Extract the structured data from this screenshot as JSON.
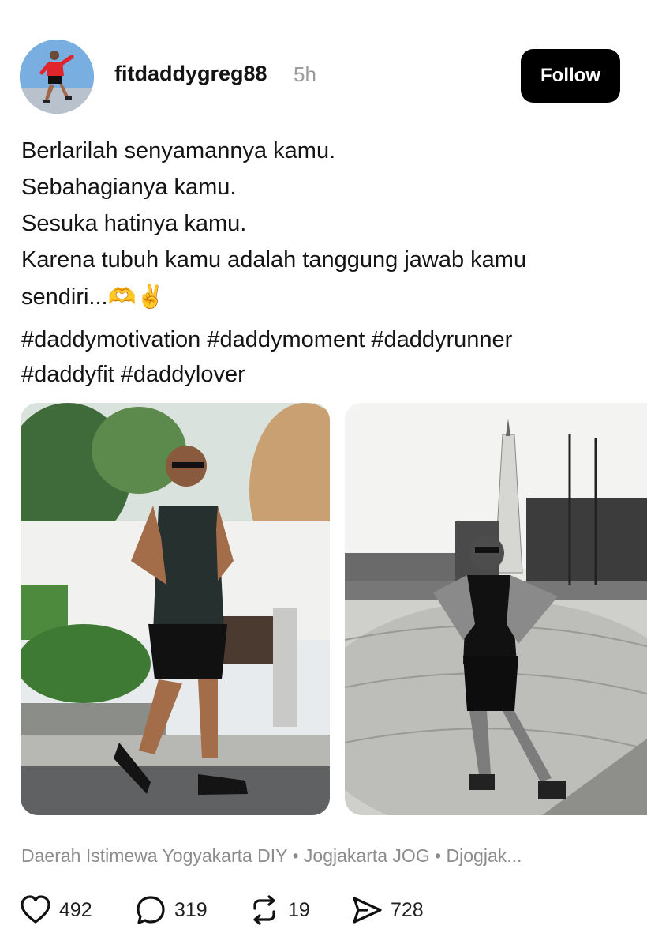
{
  "post": {
    "username": "fitdaddygreg88",
    "time": "5h",
    "follow_label": "Follow",
    "caption_lines": [
      "Berlarilah senyamannya kamu.",
      "Sebahagianya kamu.",
      "Sesuka hatinya kamu.",
      "Karena tubuh kamu adalah tanggung jawab kamu",
      "sendiri..."
    ],
    "caption_emojis": "🫶✌️",
    "hashtags_line1": "#daddymotivation #daddymoment #daddyrunner",
    "hashtags_line2": "#daddyfit #daddylover",
    "location": "Daerah Istimewa Yogyakarta DIY • Jogjakarta JOG • Djogjak...",
    "stats": {
      "likes": "492",
      "comments": "319",
      "reposts": "19",
      "shares": "728"
    },
    "icons": {
      "like": "heart-icon",
      "comment": "comment-bubble-icon",
      "repost": "repost-icon",
      "share": "send-icon"
    }
  }
}
